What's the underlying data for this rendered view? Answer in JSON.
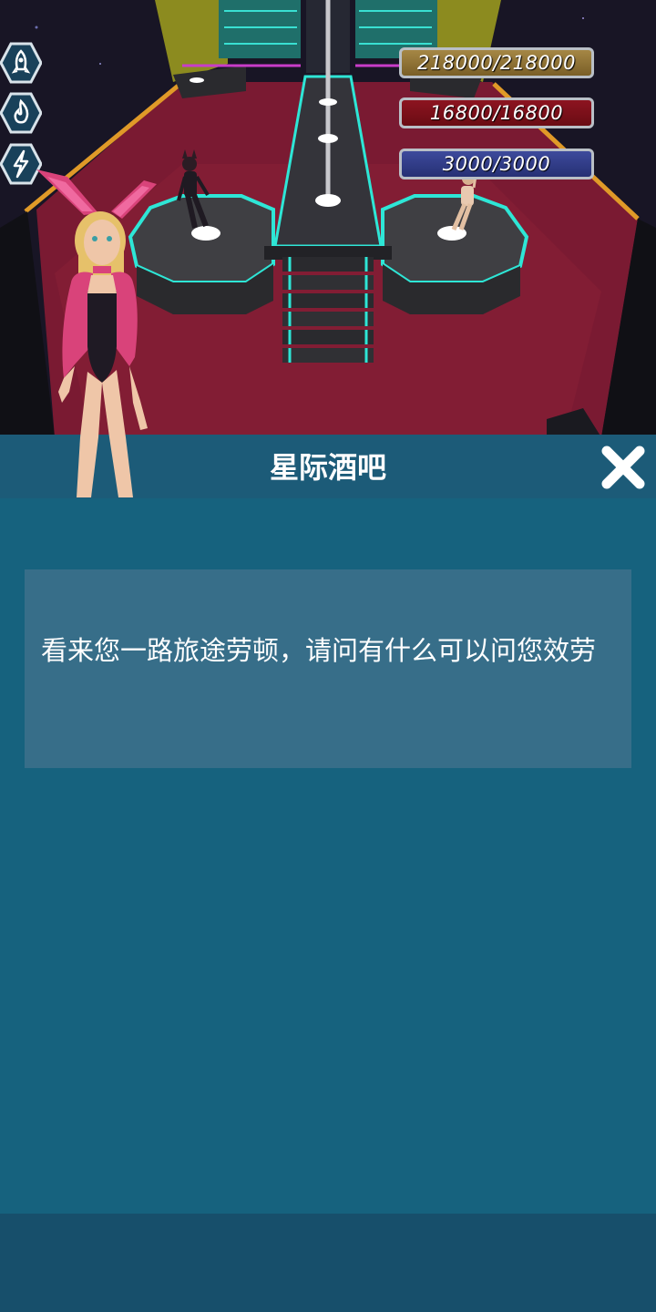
{
  "resources": {
    "gold": {
      "value": "218000/218000",
      "icon": "rocket-icon",
      "color": "#a58745"
    },
    "red": {
      "value": "16800/16800",
      "icon": "flame-icon",
      "color": "#8d1420"
    },
    "blue": {
      "value": "3000/3000",
      "icon": "lightning-icon",
      "color": "#3d4a9c"
    }
  },
  "dialog": {
    "title": "星际酒吧",
    "message": "看来您一路旅途劳顿，请问有什么可以问您效劳"
  },
  "colors": {
    "panel": "#17637e",
    "panel_header": "#1c5b78",
    "message_box": "#376e89",
    "carpet": "#7a1a32",
    "neon": "#2ee6d6"
  }
}
